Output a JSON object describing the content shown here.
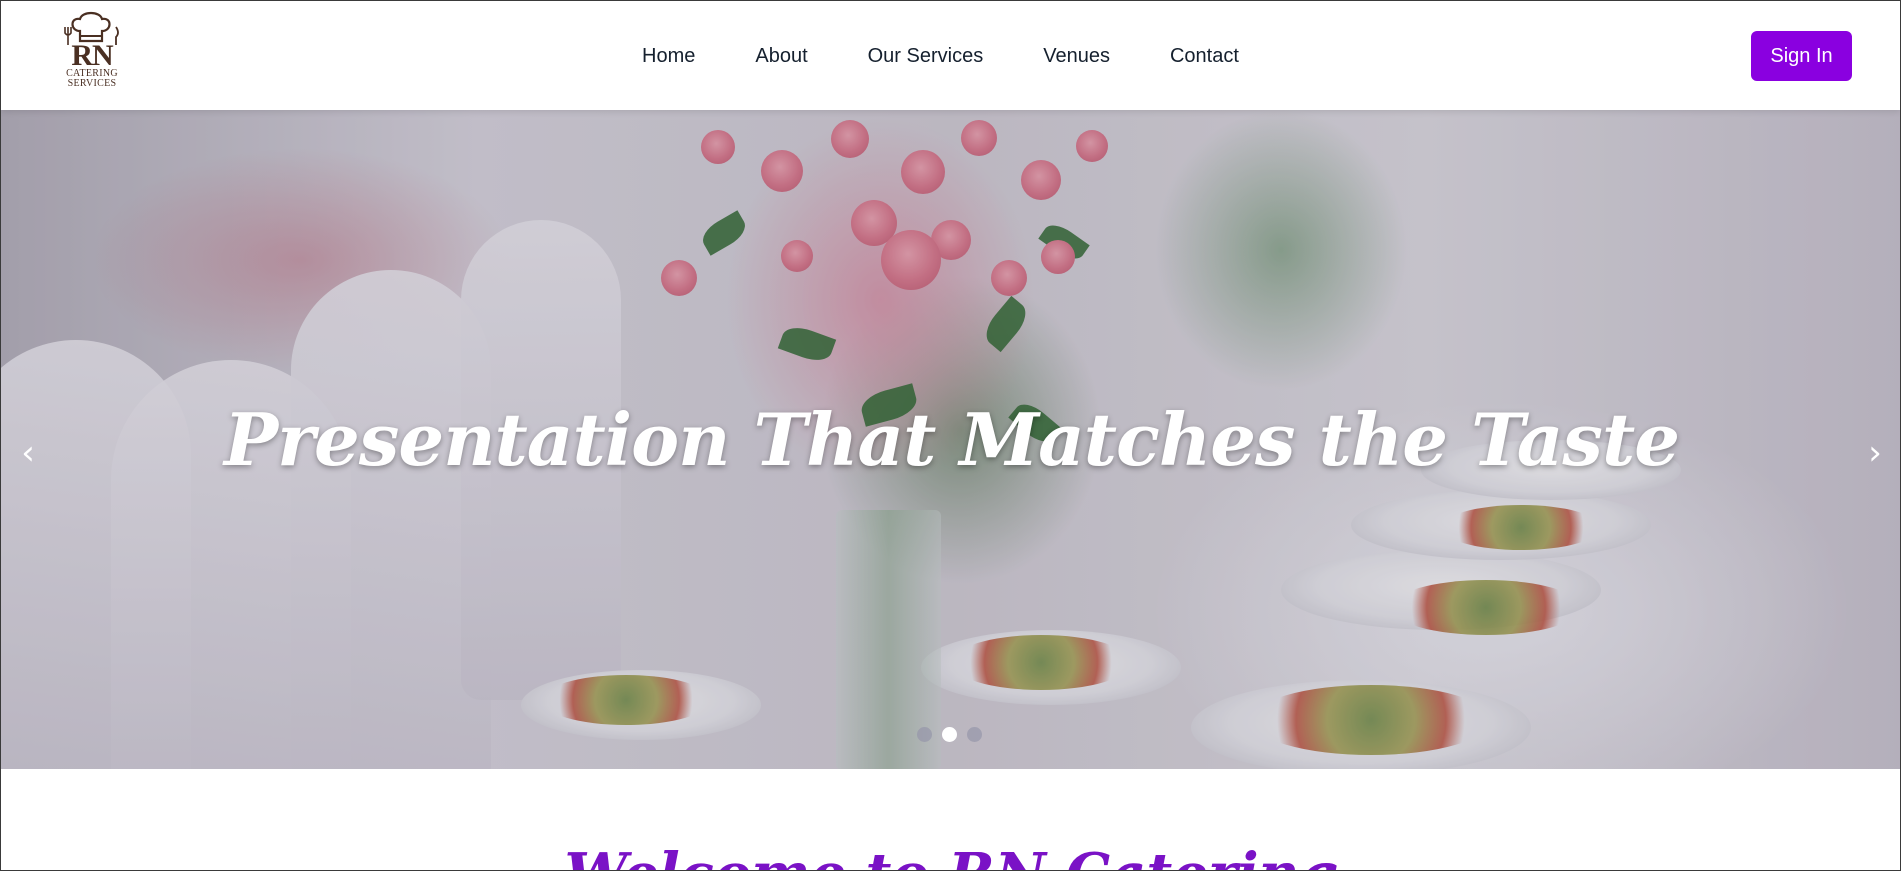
{
  "brand": {
    "logo_mark": "RN",
    "logo_sub_line1": "CATERING",
    "logo_sub_line2": "SERVICES",
    "logo_icon": "chef-hat-icon",
    "color": "#4a2f22"
  },
  "nav": {
    "items": [
      {
        "label": "Home"
      },
      {
        "label": "About"
      },
      {
        "label": "Our Services"
      },
      {
        "label": "Venues"
      },
      {
        "label": "Contact"
      }
    ]
  },
  "header": {
    "signin_label": "Sign In",
    "accent_color": "#8a00e0"
  },
  "hero": {
    "title": "Presentation That Matches the Taste",
    "prev_icon": "chevron-left-icon",
    "prev_glyph": "‹",
    "next_icon": "chevron-right-icon",
    "next_glyph": "›",
    "slide_count": 3,
    "active_slide": 2
  },
  "welcome": {
    "heading": "Welcome to RN Catering"
  }
}
